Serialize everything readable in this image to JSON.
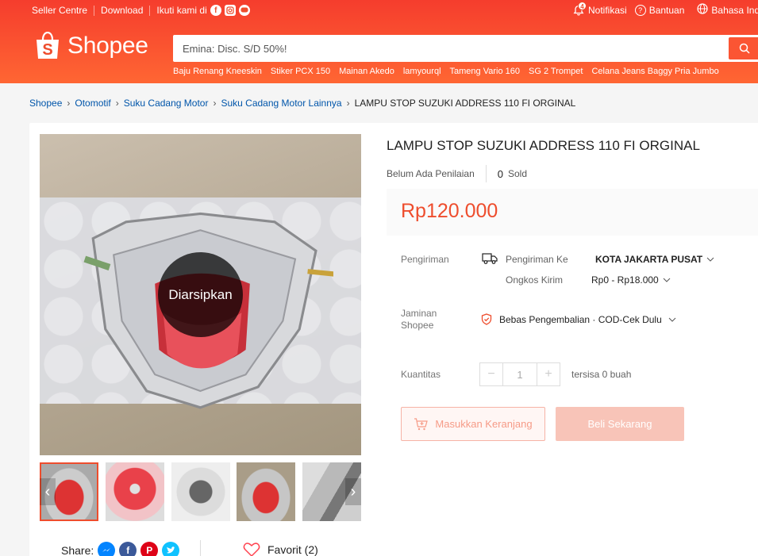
{
  "topbar": {
    "seller_centre": "Seller Centre",
    "download": "Download",
    "follow": "Ikuti kami di",
    "notif_count": "4",
    "notifikasi": "Notifikasi",
    "bantuan": "Bantuan",
    "bahasa": "Bahasa Ind"
  },
  "logo": {
    "text": "Shopee",
    "bag_letter": "S"
  },
  "search": {
    "placeholder": "Emina: Disc. S/D 50%!",
    "suggestions": [
      "Baju Renang Kneeskin",
      "Stiker PCX 150",
      "Mainan Akedo",
      "lamyourql",
      "Tameng Vario 160",
      "SG 2 Trompet",
      "Celana Jeans Baggy Pria Jumbo"
    ]
  },
  "breadcrumb": {
    "items": [
      "Shopee",
      "Otomotif",
      "Suku Cadang Motor",
      "Suku Cadang Motor Lainnya"
    ],
    "current": "LAMPU STOP SUZUKI ADDRESS 110 FI ORGINAL"
  },
  "product": {
    "title": "LAMPU STOP SUZUKI ADDRESS 110 FI ORGINAL",
    "rating_text": "Belum Ada Penilaian",
    "sold_count": "0",
    "sold_label": "Sold",
    "price": "Rp120.000",
    "archived_label": "Diarsipkan"
  },
  "shipping": {
    "label": "Pengiriman",
    "to_label": "Pengiriman Ke",
    "to_value": "KOTA JAKARTA PUSAT",
    "cost_label": "Ongkos Kirim",
    "cost_value": "Rp0 - Rp18.000"
  },
  "guarantee": {
    "label_line1": "Jaminan",
    "label_line2": "Shopee",
    "value": "Bebas Pengembalian · COD-Cek Dulu"
  },
  "quantity": {
    "label": "Kuantitas",
    "minus": "−",
    "value": "1",
    "plus": "+",
    "stock": "tersisa 0 buah"
  },
  "actions": {
    "cart": "Masukkan Keranjang",
    "buy": "Beli Sekarang"
  },
  "share": {
    "label": "Share:",
    "favorite": "Favorit (2)"
  },
  "colors": {
    "brand": "#ee4d2d",
    "link": "#0055aa"
  },
  "icons": [
    "facebook-icon",
    "instagram-icon",
    "line-icon",
    "bell-icon",
    "help-icon",
    "globe-icon",
    "search-icon",
    "truck-icon",
    "shield-icon",
    "cart-icon",
    "messenger-icon",
    "pinterest-icon",
    "twitter-icon",
    "heart-icon"
  ]
}
